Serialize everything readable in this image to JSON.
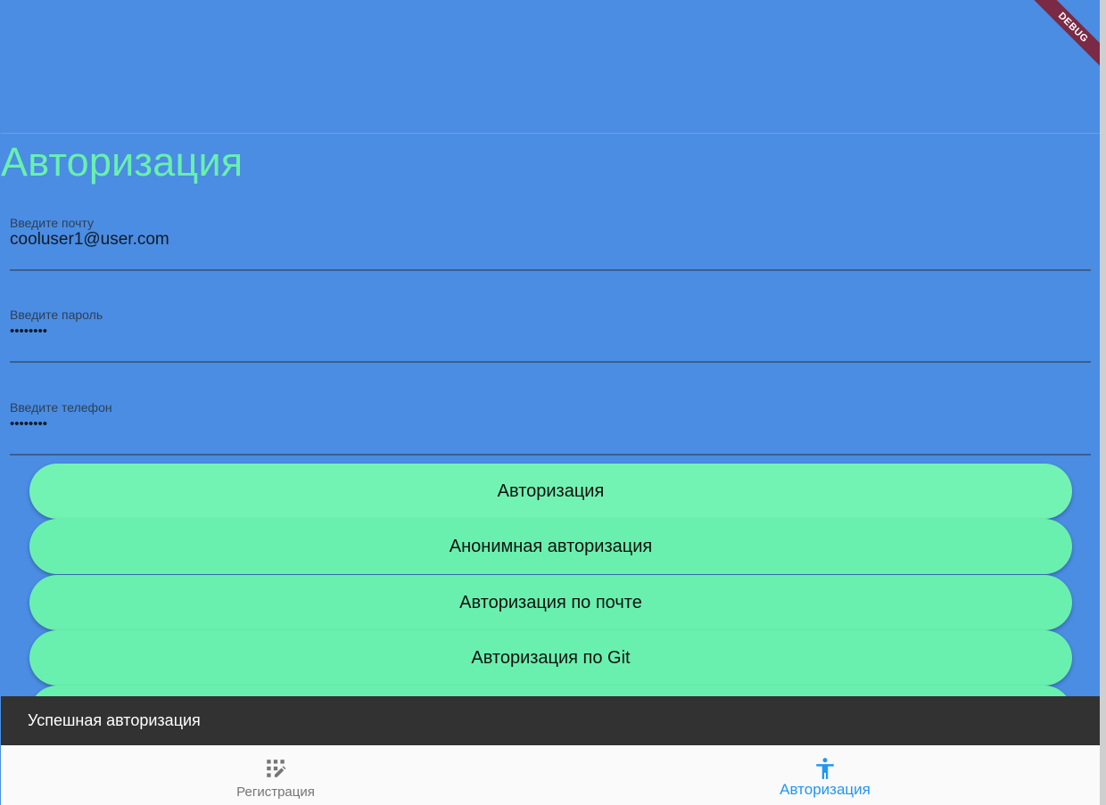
{
  "debug_banner": "DEBUG",
  "page": {
    "title": "Авторизация"
  },
  "form": {
    "email": {
      "label": "Введите почту",
      "value": "cooluser1@user.com"
    },
    "password": {
      "label": "Введите пароль",
      "value": "••••••••"
    },
    "phone": {
      "label": "Введите телефон",
      "value": "••••••••"
    }
  },
  "buttons": [
    {
      "label": "Авторизация"
    },
    {
      "label": "Анонимная авторизация"
    },
    {
      "label": "Авторизация по почте"
    },
    {
      "label": "Авторизация по Git"
    }
  ],
  "snackbar": {
    "message": "Успешная авторизация"
  },
  "bottom_nav": {
    "items": [
      {
        "label": "Регистрация",
        "icon": "app-registration-icon",
        "active": false
      },
      {
        "label": "Авторизация",
        "icon": "accessibility-icon",
        "active": true
      }
    ]
  },
  "colors": {
    "background": "#4a8de3",
    "accent_green": "#69f0ae",
    "snackbar": "#323232",
    "nav_active": "#2196f3",
    "nav_inactive": "#757575"
  }
}
